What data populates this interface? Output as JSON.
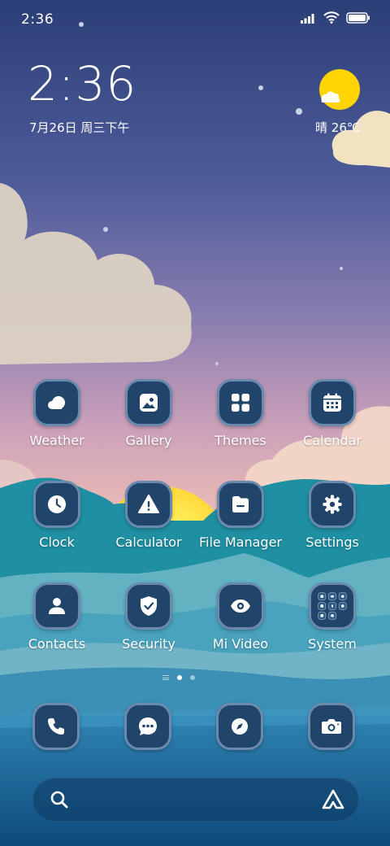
{
  "status_bar": {
    "time": "2:36"
  },
  "clock_widget": {
    "time": "2:36",
    "date": "7月26日 周三下午"
  },
  "weather_widget": {
    "condition": "晴",
    "temperature": "26℃",
    "icon": "sun-cloud-icon"
  },
  "apps": [
    {
      "label": "Weather",
      "icon": "weather-icon"
    },
    {
      "label": "Gallery",
      "icon": "gallery-icon"
    },
    {
      "label": "Themes",
      "icon": "themes-icon"
    },
    {
      "label": "Calendar",
      "icon": "calendar-icon"
    },
    {
      "label": "Clock",
      "icon": "clock-icon"
    },
    {
      "label": "Calculator",
      "icon": "calculator-icon"
    },
    {
      "label": "File Manager",
      "icon": "file-manager-icon"
    },
    {
      "label": "Settings",
      "icon": "settings-icon"
    },
    {
      "label": "Contacts",
      "icon": "contacts-icon"
    },
    {
      "label": "Security",
      "icon": "security-icon"
    },
    {
      "label": "Mi Video",
      "icon": "mi-video-icon"
    },
    {
      "label": "System",
      "icon": "folder-icon"
    }
  ],
  "dock": [
    {
      "icon": "phone-icon"
    },
    {
      "icon": "messages-icon"
    },
    {
      "icon": "browser-icon"
    },
    {
      "icon": "camera-icon"
    }
  ],
  "search": {
    "placeholder": ""
  },
  "colors": {
    "icon_bg": "#21456a",
    "icon_border": "#6a89ad",
    "sun": "#ffd400"
  }
}
